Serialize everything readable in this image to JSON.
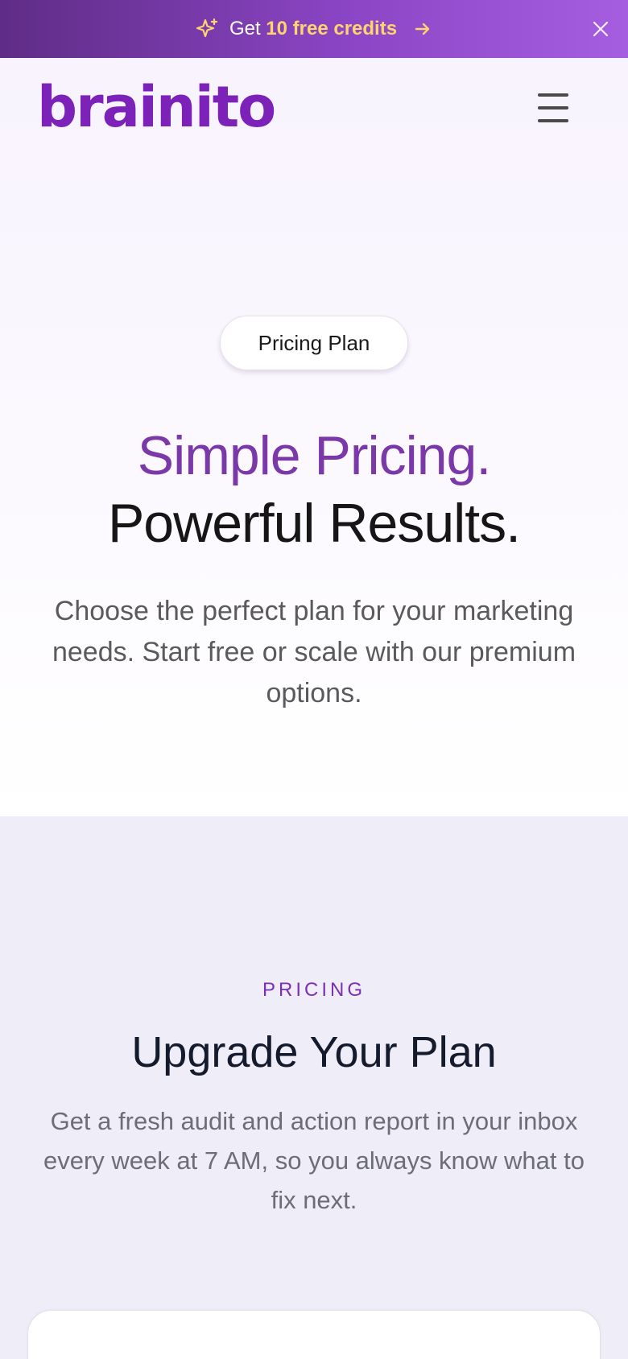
{
  "promo": {
    "text_prefix": "Get",
    "text_highlight": "10 free credits",
    "sparkle_icon": "sparkle-icon",
    "arrow_icon": "arrow-right-icon",
    "close_icon": "close-icon",
    "highlight_color": "#ffd36e"
  },
  "header": {
    "logo_text": "brainito",
    "menu_icon": "hamburger-menu-icon",
    "brand_color": "#7c22b8"
  },
  "hero": {
    "badge": "Pricing Plan",
    "title_line1": "Simple Pricing.",
    "title_line2": "Powerful Results.",
    "subtitle": "Choose the perfect plan for your marketing needs. Start free or scale with our premium options."
  },
  "pricing": {
    "eyebrow": "PRICING",
    "title": "Upgrade Your Plan",
    "subtitle": "Get a fresh audit and action report in your inbox every week at 7 AM, so you always know what to fix next."
  }
}
